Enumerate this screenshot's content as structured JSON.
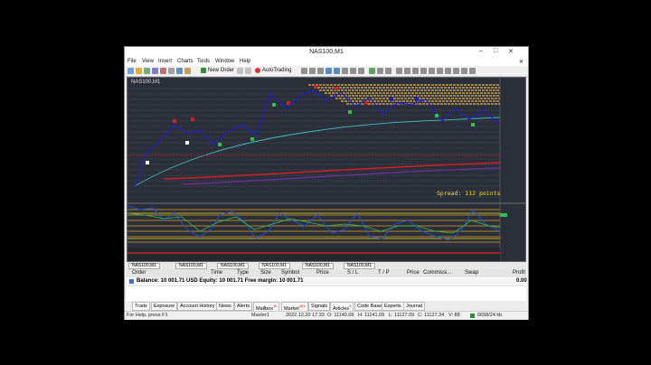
{
  "window": {
    "title": "NAS100,M1",
    "controls": [
      "–",
      "□",
      "✕"
    ]
  },
  "menu": [
    "File",
    "View",
    "Insert",
    "Charts",
    "Tools",
    "Window",
    "Help"
  ],
  "toolbar": {
    "new_order": "New Order",
    "autotrading": "AutoTrading"
  },
  "chart": {
    "symbol_label": "NAS100,M1",
    "spread_text": "Spread: 112 points",
    "colors": {
      "background": "#2b2f3a",
      "grid": "#555c6a",
      "price_line": "#2020c8",
      "ma_cyan": "#40c0c0",
      "ma_red": "#d02020",
      "ma_purple": "#7030a0",
      "ma_green": "#30c050",
      "zone_orange": "#e0a020",
      "spread_yellow": "#f0e020"
    }
  },
  "chart_tabs": [
    "NAS100,M1",
    "NAS100,M1",
    "NAS100,M1",
    "NAS100,M1",
    "NAS100,M1",
    "NAS100,M1"
  ],
  "terminal": {
    "columns": [
      "Order",
      "Time",
      "Type",
      "Size",
      "Symbol",
      "Price",
      "S / L",
      "T / P",
      "Price",
      "Commissi...",
      "Swap",
      "Profit"
    ],
    "balance_line": "Balance: 10 001.71 USD  Equity: 10 001.71  Free margin: 10 001.71",
    "profit": "0.00",
    "tabs": [
      {
        "label": "Trade",
        "badge": ""
      },
      {
        "label": "Exposure",
        "badge": ""
      },
      {
        "label": "Account History",
        "badge": ""
      },
      {
        "label": "News",
        "badge": ""
      },
      {
        "label": "Alerts",
        "badge": ""
      },
      {
        "label": "Mailbox",
        "badge": "12"
      },
      {
        "label": "Market",
        "badge": "101"
      },
      {
        "label": "Signals",
        "badge": ""
      },
      {
        "label": "Articles",
        "badge": "4"
      },
      {
        "label": "Code Base",
        "badge": ""
      },
      {
        "label": "Experts",
        "badge": ""
      },
      {
        "label": "Journal",
        "badge": ""
      }
    ]
  },
  "status": {
    "help": "For Help, press F1",
    "profile": "Master1",
    "datetime": "2022.12.20 17:33",
    "open": "O: 11140.09",
    "high": "H: 11141.09",
    "low": "L: 11127.09",
    "close": "C: 11127.34",
    "volume": "V: 88",
    "traffic": "6658/24 kb"
  }
}
